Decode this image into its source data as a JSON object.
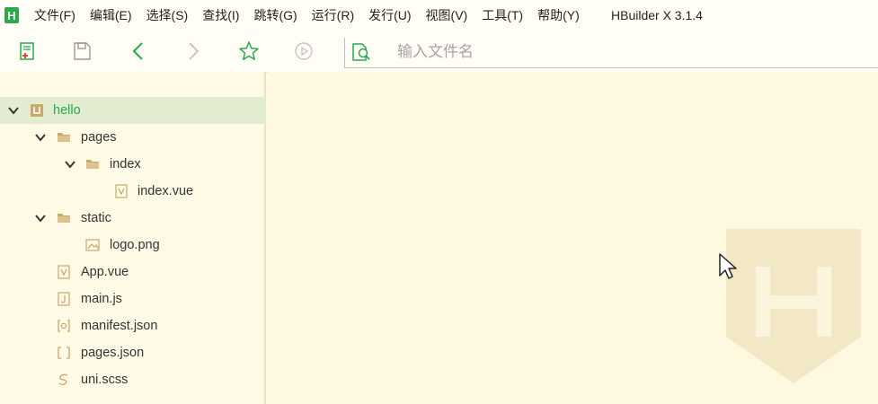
{
  "app": {
    "logo_letter": "H",
    "title": "HBuilder X 3.1.4"
  },
  "menu": {
    "items": [
      {
        "label": "文件(F)"
      },
      {
        "label": "编辑(E)"
      },
      {
        "label": "选择(S)"
      },
      {
        "label": "查找(I)"
      },
      {
        "label": "跳转(G)"
      },
      {
        "label": "运行(R)"
      },
      {
        "label": "发行(U)"
      },
      {
        "label": "视图(V)"
      },
      {
        "label": "工具(T)"
      },
      {
        "label": "帮助(Y)"
      }
    ]
  },
  "toolbar": {
    "search_placeholder": "输入文件名"
  },
  "tree": {
    "items": [
      {
        "label": "hello",
        "icon": "project-icon",
        "expanded": true,
        "selected": true
      },
      {
        "label": "pages",
        "icon": "folder-icon",
        "expanded": true
      },
      {
        "label": "index",
        "icon": "folder-icon",
        "expanded": true
      },
      {
        "label": "index.vue",
        "icon": "vue-file-icon"
      },
      {
        "label": "static",
        "icon": "folder-icon",
        "expanded": true
      },
      {
        "label": "logo.png",
        "icon": "image-file-icon"
      },
      {
        "label": "App.vue",
        "icon": "vue-file-icon"
      },
      {
        "label": "main.js",
        "icon": "js-file-icon"
      },
      {
        "label": "manifest.json",
        "icon": "manifest-file-icon"
      },
      {
        "label": "pages.json",
        "icon": "json-file-icon"
      },
      {
        "label": "uni.scss",
        "icon": "scss-file-icon"
      }
    ]
  },
  "colors": {
    "accent": "#2aa84a",
    "background": "#fffae6",
    "selected_row": "#e2ecd0",
    "folder": "#c8a86b"
  }
}
